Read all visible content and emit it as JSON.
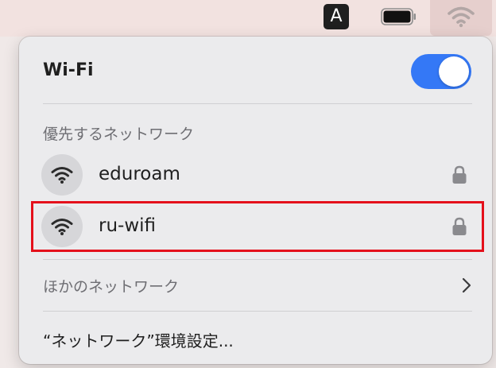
{
  "menubar": {
    "input_method_label": "A",
    "icons": [
      "input-method-icon",
      "battery-icon",
      "wifi-icon"
    ]
  },
  "wifi_panel": {
    "title": "Wi-Fi",
    "toggle_on": true,
    "preferred_header": "優先するネットワーク",
    "networks": [
      {
        "name": "eduroam",
        "icon": "wifi-icon",
        "secured": true
      },
      {
        "name": "ru-wifi",
        "icon": "wifi-icon",
        "secured": true
      }
    ],
    "other_networks_label": "ほかのネットワーク",
    "preferences_label": "“ネットワーク”環境設定..."
  },
  "colors": {
    "toggle_on": "#3478f6",
    "highlight": "#e4101b",
    "panel_bg": "#ebebed",
    "menubar_bg": "#f2e2e0"
  }
}
